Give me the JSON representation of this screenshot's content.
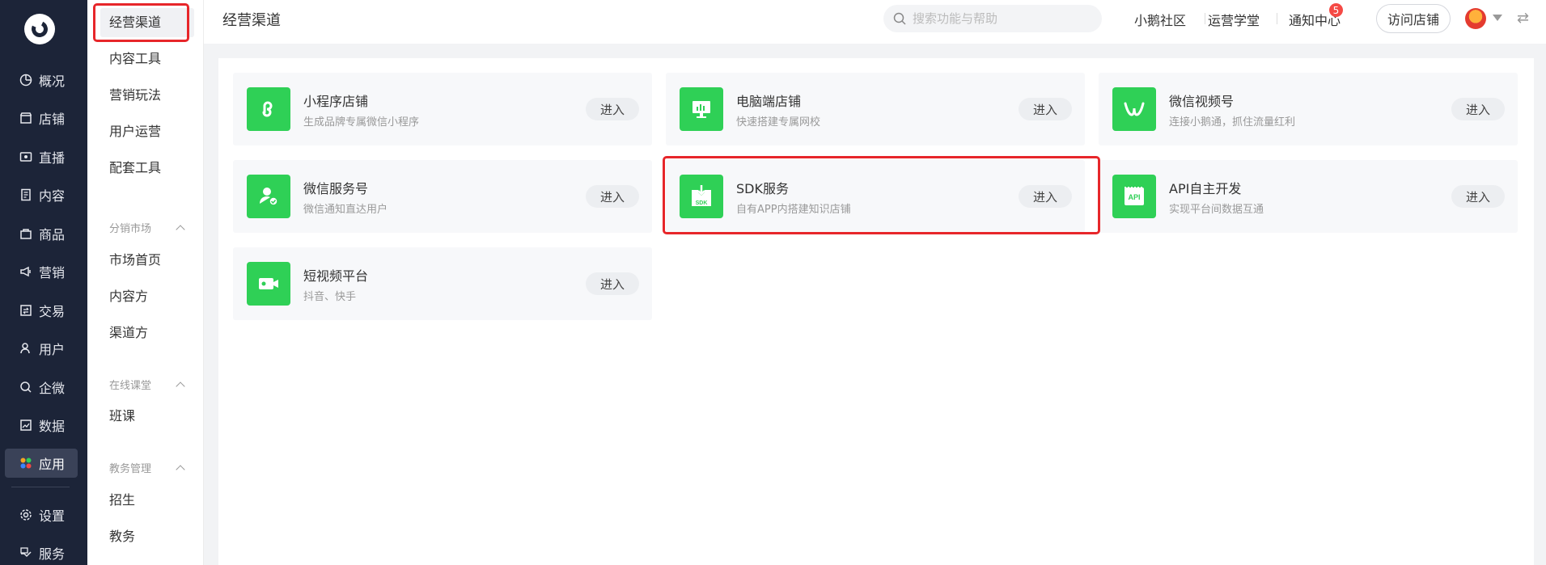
{
  "nav": {
    "items": [
      {
        "label": "概况",
        "icon": "pie-chart-icon"
      },
      {
        "label": "店铺",
        "icon": "store-icon"
      },
      {
        "label": "直播",
        "icon": "live-icon"
      },
      {
        "label": "内容",
        "icon": "document-icon"
      },
      {
        "label": "商品",
        "icon": "goods-icon"
      },
      {
        "label": "营销",
        "icon": "megaphone-icon"
      },
      {
        "label": "交易",
        "icon": "transaction-icon"
      },
      {
        "label": "用户",
        "icon": "user-icon"
      },
      {
        "label": "企微",
        "icon": "wecom-icon"
      },
      {
        "label": "数据",
        "icon": "data-icon"
      },
      {
        "label": "应用",
        "icon": "apps-icon",
        "active": true
      },
      {
        "label": "设置",
        "icon": "gear-icon"
      },
      {
        "label": "服务",
        "icon": "service-icon"
      }
    ]
  },
  "submenu": {
    "items": [
      "经营渠道",
      "内容工具",
      "营销玩法",
      "用户运营",
      "配套工具"
    ],
    "groups": [
      {
        "title": "分销市场",
        "items": [
          "市场首页",
          "内容方",
          "渠道方"
        ]
      },
      {
        "title": "在线课堂",
        "items": [
          "班课"
        ]
      },
      {
        "title": "教务管理",
        "items": [
          "招生",
          "教务"
        ]
      }
    ]
  },
  "header": {
    "title": "经营渠道",
    "search_placeholder": "搜索功能与帮助",
    "links": [
      "小鹅社区",
      "运营学堂",
      "通知中心"
    ],
    "notification_count": "5",
    "visit_button": "访问店铺"
  },
  "cards": [
    {
      "title": "小程序店铺",
      "desc": "生成品牌专属微信小程序",
      "button": "进入",
      "icon": "mini-program-icon"
    },
    {
      "title": "电脑端店铺",
      "desc": "快速搭建专属网校",
      "button": "进入",
      "icon": "desktop-icon"
    },
    {
      "title": "微信视频号",
      "desc": "连接小鹅通，抓住流量红利",
      "button": "进入",
      "icon": "channels-icon"
    },
    {
      "title": "微信服务号",
      "desc": "微信通知直达用户",
      "button": "进入",
      "icon": "service-account-icon"
    },
    {
      "title": "SDK服务",
      "desc": "自有APP内搭建知识店铺",
      "button": "进入",
      "icon": "sdk-icon",
      "icon_text": "SDK"
    },
    {
      "title": "API自主开发",
      "desc": "实现平台间数据互通",
      "button": "进入",
      "icon": "api-icon",
      "icon_text": "API"
    },
    {
      "title": "短视频平台",
      "desc": "抖音、快手",
      "button": "进入",
      "icon": "video-camera-icon"
    }
  ],
  "colors": {
    "nav_bg": "#1c2438",
    "accent_green": "#2fd056",
    "highlight_red": "#e7262a"
  }
}
